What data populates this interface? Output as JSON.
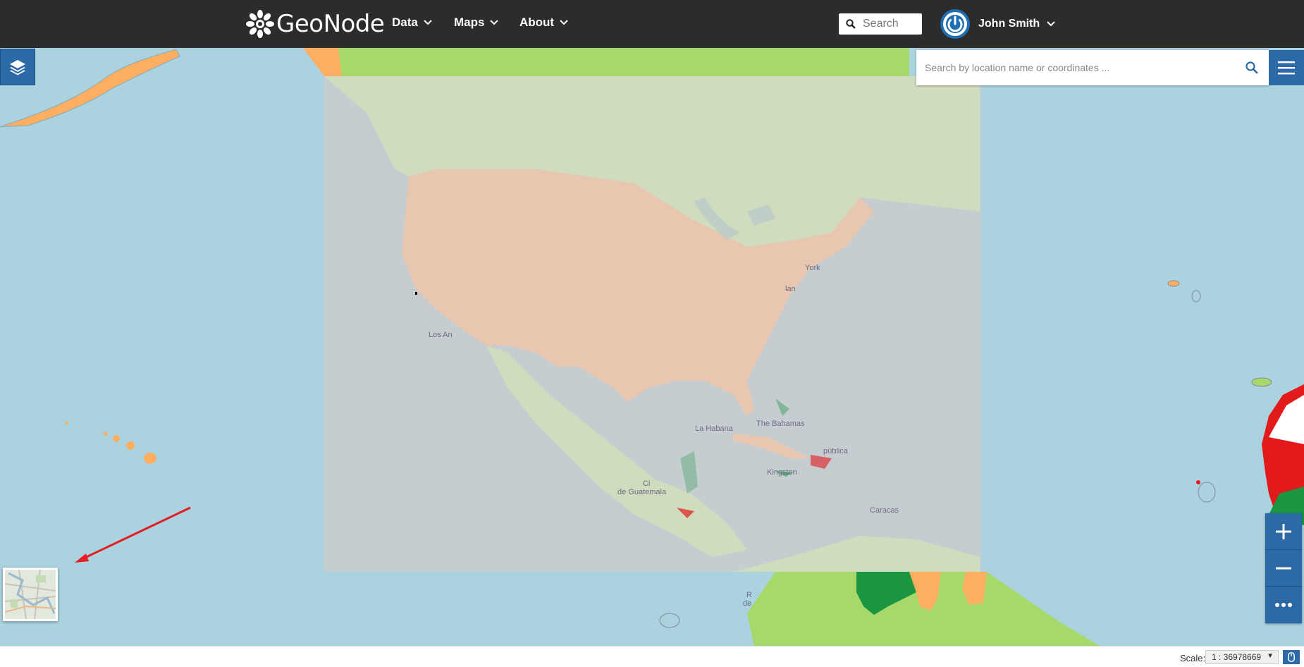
{
  "header": {
    "brand": "GeoNode",
    "nav": [
      {
        "label": "Data"
      },
      {
        "label": "Maps"
      },
      {
        "label": "About"
      }
    ],
    "search_placeholder": "Search",
    "user_name": "John Smith"
  },
  "map": {
    "search_placeholder": "Search by location name or coordinates ...",
    "labels": {
      "york": "York",
      "los_angeles": "Los An",
      "habana": "La Habana",
      "bahamas": "The Bahamas",
      "republica": "pública",
      "kingston": "Kingston",
      "guatemala1": "Ci",
      "guatemala2": "de Guatemala",
      "caracas": "Caracas",
      "r": "R",
      "de": "de",
      "lan": "lan"
    },
    "colors": {
      "ocean": "#aad3df",
      "overlay": "#c6cdd1",
      "usa": "#e9c6b0",
      "green": "#cfdcbd",
      "lightgreen": "#a6d96a",
      "darkgreen": "#1a9641",
      "orange": "#fdae61",
      "red": "#e31a1c",
      "accent": "#2b6aa6"
    }
  },
  "footer": {
    "scale_label": "Scale:",
    "scale_value": "1 : 36978669"
  }
}
